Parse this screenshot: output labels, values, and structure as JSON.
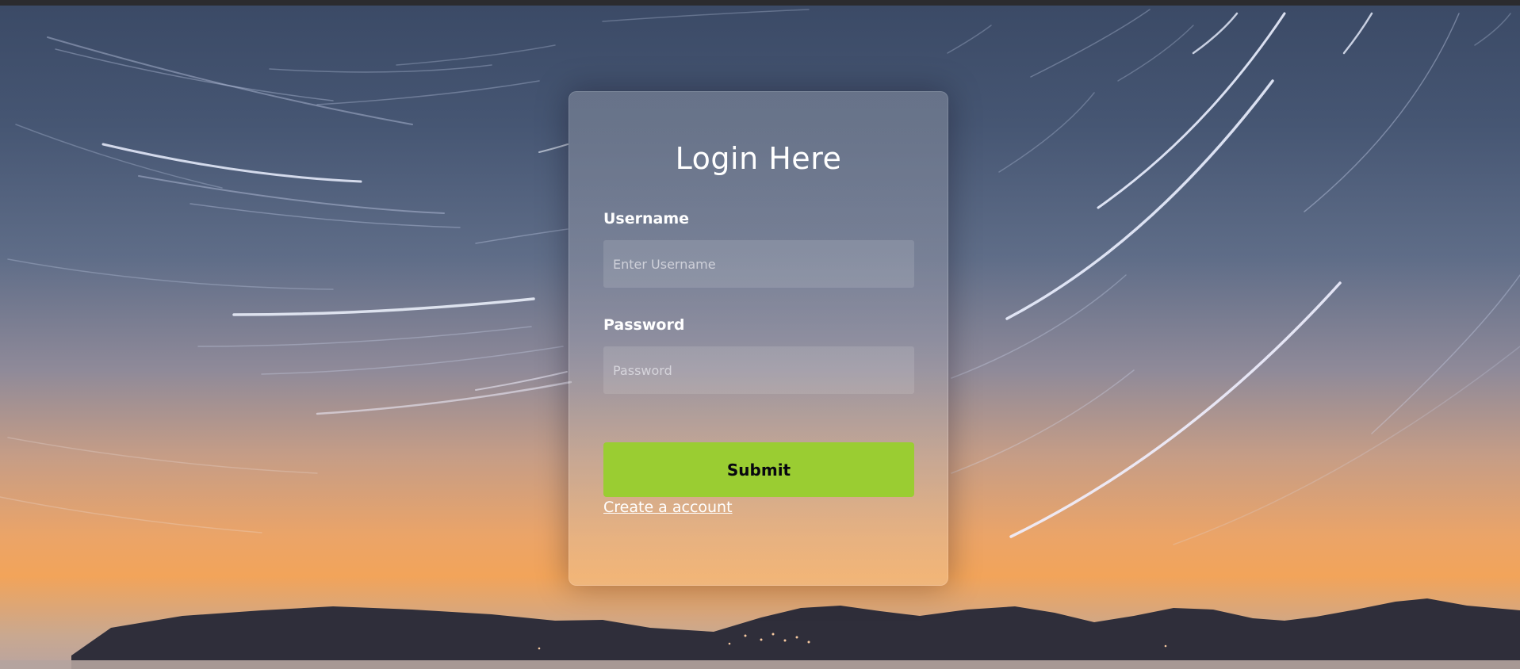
{
  "window": {
    "top_bar_color": "#2b2b2e"
  },
  "background": {
    "description_icon": "star-trails-sunset",
    "sky_top_color": "#3b4a66",
    "horizon_color": "#f2a45a",
    "mountain_color": "#2f2e3a"
  },
  "login_form": {
    "title": "Login Here",
    "username": {
      "label": "Username",
      "placeholder": "Enter Username",
      "value": ""
    },
    "password": {
      "label": "Password",
      "placeholder": "Password",
      "value": ""
    },
    "submit_label": "Submit",
    "create_account_link": "Create a account"
  },
  "colors": {
    "accent": "#9acd32",
    "card_text": "#ffffff",
    "button_text": "#080710"
  }
}
